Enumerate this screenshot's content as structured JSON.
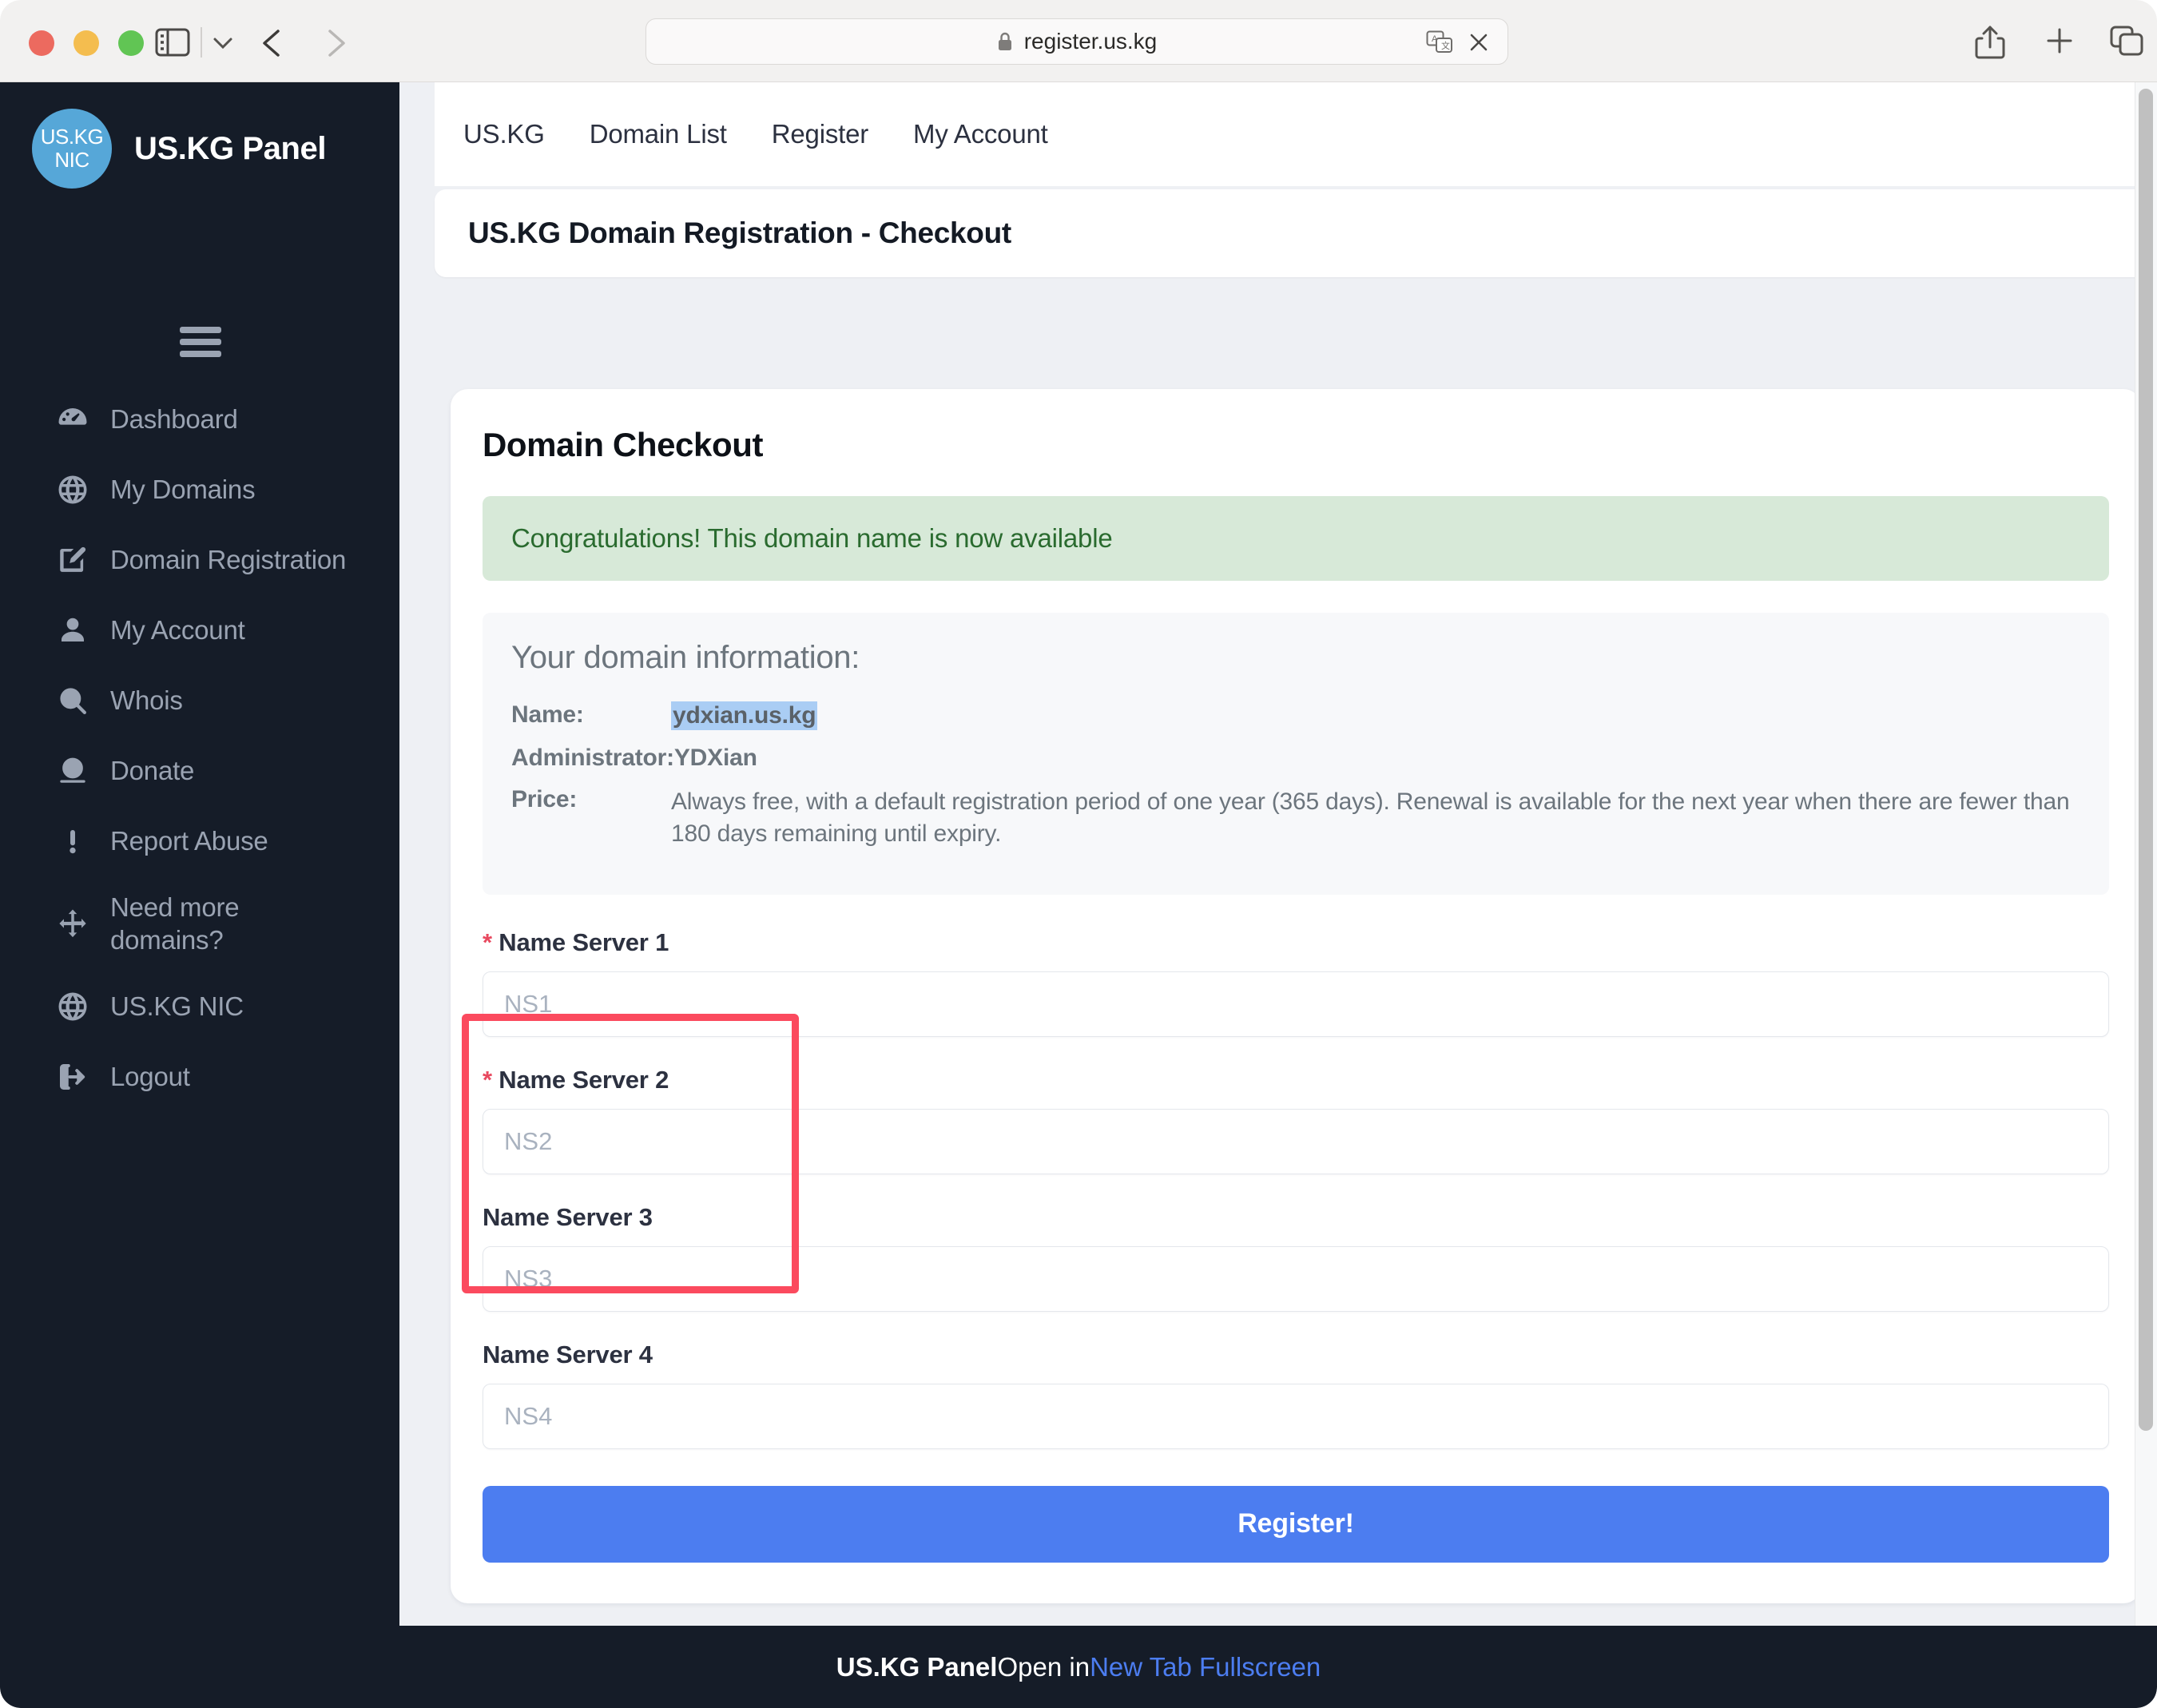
{
  "browser": {
    "url": "register.us.kg",
    "lock_icon": "lock-icon",
    "translate_icon": "translate-icon",
    "close_icon": "close-icon",
    "sidebar_toggle_icon": "sidebar-toggle-icon",
    "chevron_down_icon": "chevron-down-icon",
    "back_icon": "chevron-left-icon",
    "forward_icon": "chevron-right-icon",
    "share_icon": "share-icon",
    "new_tab_icon": "plus-icon",
    "tabs_icon": "tab-overview-icon"
  },
  "sidebar": {
    "logo_line1": "US.KG",
    "logo_line2": "NIC",
    "title": "US.KG Panel",
    "logo_color": "#56a7d8",
    "bg_color": "#151c28",
    "items": [
      {
        "label": "Dashboard",
        "icon": "gauge-icon"
      },
      {
        "label": "My Domains",
        "icon": "globe-icon"
      },
      {
        "label": "Domain Registration",
        "icon": "edit-pen-icon"
      },
      {
        "label": "My Account",
        "icon": "user-icon"
      },
      {
        "label": "Whois",
        "icon": "search-icon"
      },
      {
        "label": "Donate",
        "icon": "money-icon"
      },
      {
        "label": "Report Abuse",
        "icon": "exclamation-icon"
      },
      {
        "label": "Need more domains?",
        "icon": "arrows-move-icon"
      },
      {
        "label": "US.KG NIC",
        "icon": "globe-icon"
      },
      {
        "label": "Logout",
        "icon": "sign-out-icon"
      }
    ]
  },
  "topnav": {
    "items": [
      {
        "label": "US.KG"
      },
      {
        "label": "Domain List"
      },
      {
        "label": "Register"
      },
      {
        "label": "My Account"
      }
    ]
  },
  "header": {
    "page_title": "US.KG Domain Registration - Checkout"
  },
  "main": {
    "card_title": "Domain Checkout",
    "alert": {
      "text": "Congratulations! This domain name is now available",
      "bg_color": "#d7e9d8",
      "text_color": "#2a6b2f"
    },
    "info": {
      "heading": "Your domain information:",
      "rows": [
        {
          "label": "Name:",
          "value": "ydxian.us.kg",
          "selected": true
        },
        {
          "label": "Administrator:",
          "value": "YDXian",
          "selected": false
        }
      ],
      "price_label": "Price:",
      "price_value": "Always free, with a default registration period of one year (365 days). Renewal is available for the next year when there are fewer than 180 days remaining until expiry."
    },
    "fields": [
      {
        "label": "Name Server 1",
        "required": true,
        "placeholder": "NS1",
        "value": ""
      },
      {
        "label": "Name Server 2",
        "required": true,
        "placeholder": "NS2",
        "value": ""
      },
      {
        "label": "Name Server 3",
        "required": false,
        "placeholder": "NS3",
        "value": ""
      },
      {
        "label": "Name Server 4",
        "required": false,
        "placeholder": "NS4",
        "value": ""
      }
    ],
    "submit_label": "Register!",
    "submit_color": "#4c7df0"
  },
  "annotation": {
    "color": "#fb4a5e",
    "describes": "Name Server 1 and Name Server 2 required fields"
  },
  "footer": {
    "brand": "US.KG Panel",
    "text": " Open in ",
    "link": "New Tab Fullscreen",
    "link_color": "#4c7df0"
  }
}
